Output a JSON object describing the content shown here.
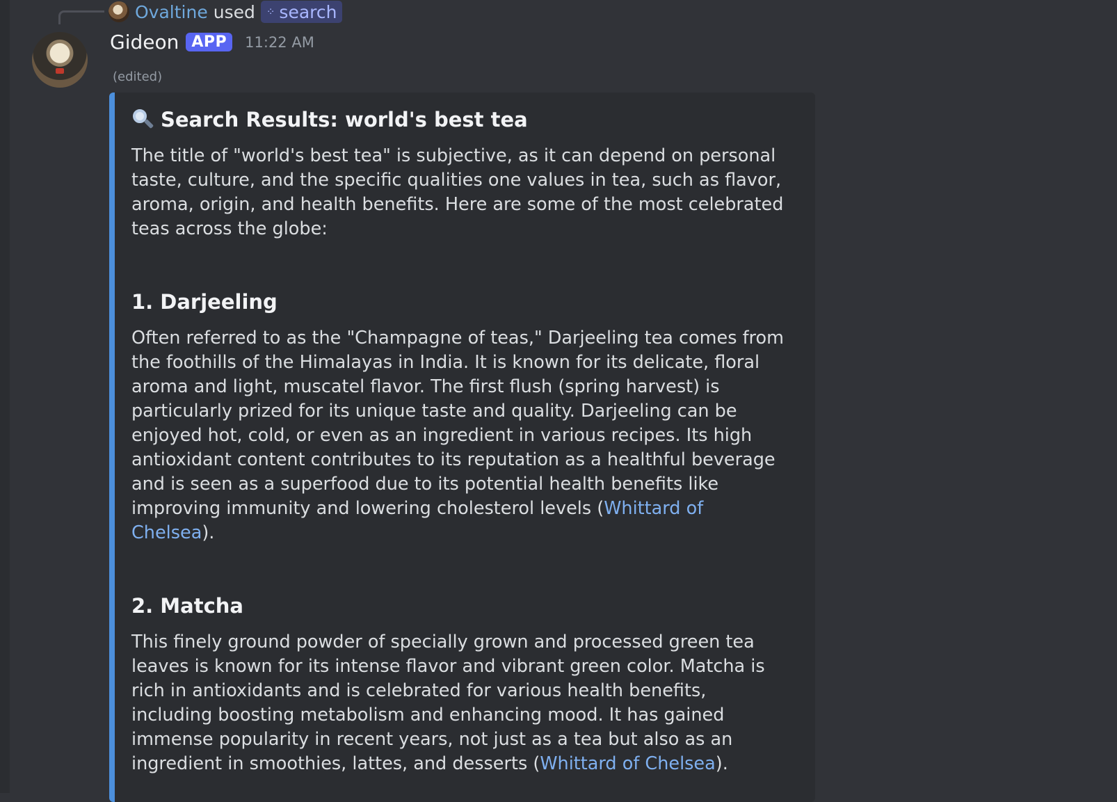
{
  "reply": {
    "user": "Ovaltine",
    "used_text": "used",
    "command": "search",
    "command_icon": "slash-command-icon"
  },
  "message": {
    "author": "Gideon",
    "badge": "APP",
    "timestamp": "11:22 AM",
    "edited": "(edited)"
  },
  "embed": {
    "accent_color": "#4c8fdc",
    "title_icon": "magnifying-glass-icon",
    "title": "Search Results: world's best tea",
    "intro": "The title of \"world's best tea\" is subjective, as it can depend on personal taste, culture, and the specific qualities one values in tea, such as flavor, aroma, origin, and health benefits. Here are some of the most celebrated teas across the globe:",
    "sections": [
      {
        "heading": "1. Darjeeling",
        "body": "Often referred to as the \"Champagne of teas,\" Darjeeling tea comes from the foothills of the Himalayas in India. It is known for its delicate, floral aroma and light, muscatel flavor. The first flush (spring harvest) is particularly prized for its unique taste and quality. Darjeeling can be enjoyed hot, cold, or even as an ingredient in various recipes. Its high antioxidant content contributes to its reputation as a healthful beverage and is seen as a superfood due to its potential health benefits like improving immunity and lowering cholesterol levels (",
        "link": "Whittard of Chelsea",
        "tail": ")."
      },
      {
        "heading": "2. Matcha",
        "body": "This finely ground powder of specially grown and processed green tea leaves is known for its intense flavor and vibrant green color. Matcha is rich in antioxidants and is celebrated for various health benefits, including boosting metabolism and enhancing mood. It has gained immense popularity in recent years, not just as a tea but also as an ingredient in smoothies, lattes, and desserts (",
        "link": "Whittard of Chelsea",
        "tail": ")."
      }
    ]
  }
}
